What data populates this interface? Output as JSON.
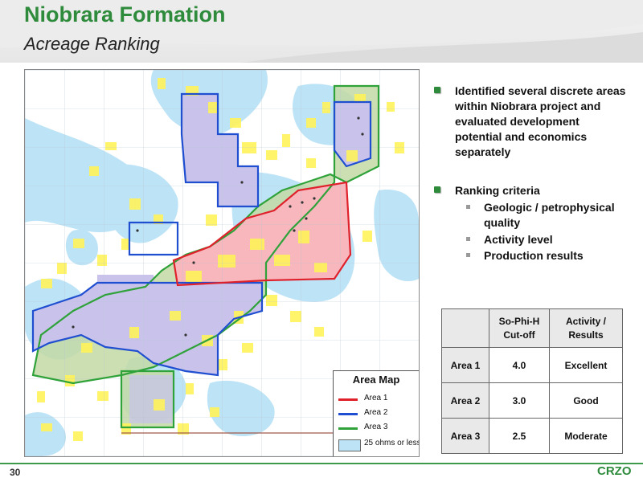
{
  "header": {
    "title": "Niobrara Formation",
    "subtitle": "Acreage Ranking"
  },
  "map": {
    "legend": {
      "title": "Area Map",
      "items": [
        {
          "label": "Area 1",
          "color": "#e0202a"
        },
        {
          "label": "Area 2",
          "color": "#1f4fd0"
        },
        {
          "label": "Area 3",
          "color": "#2fa23a"
        },
        {
          "label": "25 ohms or less",
          "color": "#bde3f6"
        }
      ]
    },
    "colors": {
      "water": "#bde3f6",
      "acreage": "#fff35a",
      "area1_fill": "#f7b7bd",
      "area2_fill": "#c9c3ec",
      "area3_fill": "#c3d9a5"
    }
  },
  "bullets": [
    {
      "text": "Identified several discrete areas within Niobrara project and evaluated development potential and economics separately",
      "subitems": []
    },
    {
      "text": "Ranking criteria",
      "subitems": [
        "Geologic / petrophysical quality",
        "Activity level",
        "Production results"
      ]
    }
  ],
  "table": {
    "headers": [
      "",
      "So-Phi-H Cut-off",
      "Activity / Results"
    ],
    "rows": [
      {
        "area": "Area 1",
        "cutoff": "4.0",
        "result": "Excellent"
      },
      {
        "area": "Area 2",
        "cutoff": "3.0",
        "result": "Good"
      },
      {
        "area": "Area 3",
        "cutoff": "2.5",
        "result": "Moderate"
      }
    ]
  },
  "footer": {
    "page_number": "30",
    "logo": "CRZO"
  }
}
